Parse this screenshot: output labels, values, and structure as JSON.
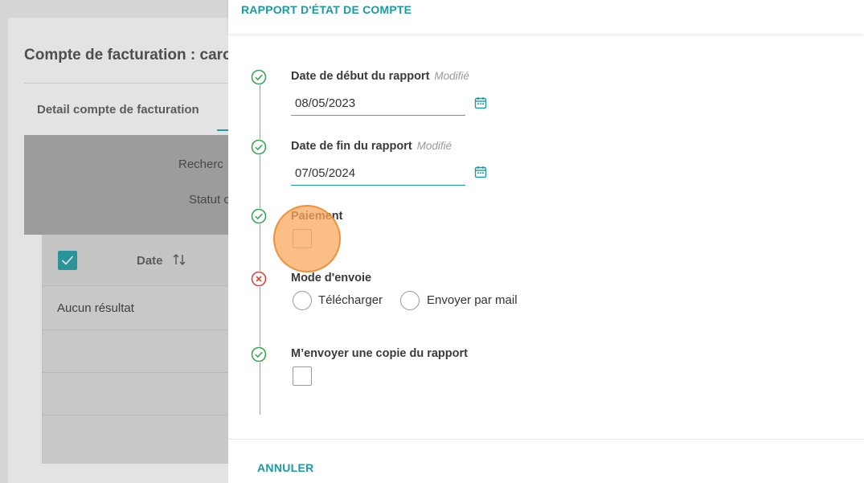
{
  "background": {
    "title": "Compte de facturation : caro",
    "tab_label": "Detail compte de facturation",
    "search_label": "Recherc",
    "status_label": "Statut c",
    "table": {
      "column_date": "Date",
      "empty_text": "Aucun résultat"
    }
  },
  "drawer": {
    "title": "RAPPORT D'ÉTAT DE COMPTE",
    "steps": [
      {
        "label": "Date de début du rapport",
        "tag": "Modifié",
        "value": "08/05/2023",
        "status": "valid"
      },
      {
        "label": "Date de fin du rapport",
        "tag": "Modifié",
        "value": "07/05/2024",
        "status": "valid"
      },
      {
        "label": "Paiement",
        "status": "valid"
      },
      {
        "label": "Mode d'envoie",
        "status": "error",
        "options": [
          "Télécharger",
          "Envoyer par mail"
        ]
      },
      {
        "label": "M’envoyer une copie du rapport",
        "status": "valid"
      }
    ],
    "cancel_label": "ANNULER"
  },
  "colors": {
    "accent": "#1a9aa3",
    "valid": "#3aa655",
    "error": "#d9443c",
    "click_indicator": "#f8a85e"
  }
}
